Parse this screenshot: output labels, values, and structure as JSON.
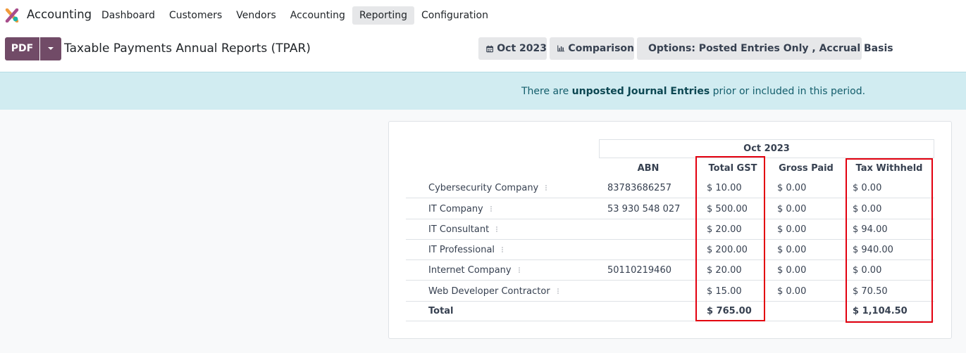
{
  "navbar": {
    "app_name": "Accounting",
    "menu": [
      {
        "label": "Dashboard",
        "active": false
      },
      {
        "label": "Customers",
        "active": false
      },
      {
        "label": "Vendors",
        "active": false
      },
      {
        "label": "Accounting",
        "active": false
      },
      {
        "label": "Reporting",
        "active": true
      },
      {
        "label": "Configuration",
        "active": false
      }
    ]
  },
  "control_panel": {
    "pdf_label": "PDF",
    "title": "Taxable Payments Annual Reports (TPAR)",
    "date_filter": "Oct 2023",
    "comparison_label": "Comparison",
    "options_label": "Options: Posted Entries Only , Accrual Basis"
  },
  "alert": {
    "prefix": "There are",
    "link": "unposted Journal Entries",
    "suffix": "prior or included in this period."
  },
  "report": {
    "period": "Oct 2023",
    "columns": [
      "ABN",
      "Total GST",
      "Gross Paid",
      "Tax Withheld"
    ],
    "rows": [
      {
        "name": "Cybersecurity Company",
        "abn": "83783686257",
        "total_gst": "$ 10.00",
        "gross_paid": "$ 0.00",
        "tax_withheld": "$ 0.00"
      },
      {
        "name": "IT Company",
        "abn": "53 930 548 027",
        "total_gst": "$ 500.00",
        "gross_paid": "$ 0.00",
        "tax_withheld": "$ 0.00"
      },
      {
        "name": "IT Consultant",
        "abn": "",
        "total_gst": "$ 20.00",
        "gross_paid": "$ 0.00",
        "tax_withheld": "$ 94.00"
      },
      {
        "name": "IT Professional",
        "abn": "",
        "total_gst": "$ 200.00",
        "gross_paid": "$ 0.00",
        "tax_withheld": "$ 940.00"
      },
      {
        "name": "Internet Company",
        "abn": "50110219460",
        "total_gst": "$ 20.00",
        "gross_paid": "$ 0.00",
        "tax_withheld": "$ 0.00"
      },
      {
        "name": "Web Developer Contractor",
        "abn": "",
        "total_gst": "$ 15.00",
        "gross_paid": "$ 0.00",
        "tax_withheld": "$ 70.50"
      }
    ],
    "total": {
      "name": "Total",
      "abn": "",
      "total_gst": "$ 765.00",
      "gross_paid": "",
      "tax_withheld": "$ 1,104.50"
    }
  },
  "colors": {
    "brand": "#714b67",
    "highlight": "#e3000f",
    "alert_bg": "#d1ecf1"
  }
}
